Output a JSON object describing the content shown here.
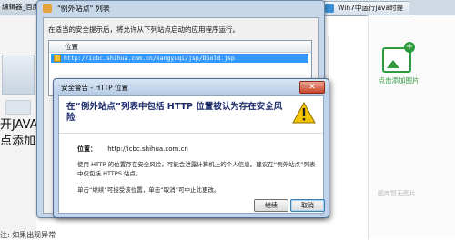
{
  "taskbar": {
    "left_item": "编辑器_百度知",
    "right_item": "Win7中运行java时提"
  },
  "background_page": {
    "text_line1": "开JAVA控",
    "text_line2": "点添加到",
    "text_line3": "注: 如果出现异常",
    "add_picture_label": "点击添加图片",
    "empty_pictures_label": "图库暂无图片"
  },
  "exception_window": {
    "title": "\"例外站点\" 列表",
    "instruction": "在适当的安全提示后，将允许从下列站点启动的应用程序运行。",
    "column_header": "位置",
    "selected_row_url": "http://icbc.shihua.com.cn/kangyuqi/jsp/DGold.jsp"
  },
  "warning_dialog": {
    "title": "安全警告 - HTTP 位置",
    "heading": "在“例外站点”列表中包括 HTTP 位置被认为存在安全风险",
    "location_label": "位置：",
    "location_value": "http://icbc.shihua.com.cn",
    "description": "使用 HTTP 的位置存在安全风险，可能会泄露计算机上的个人信息。建议在“例外站点”列表中仅包括 HTTPS 站点。",
    "hint": "单击“继续”可接受该位置，单击“取消”可中止此更改。",
    "continue_label": "继续",
    "cancel_label": "取消",
    "icon": "warning-triangle-icon",
    "colors": {
      "heading": "#1b2a6b",
      "triangle": "#f5c400"
    }
  }
}
